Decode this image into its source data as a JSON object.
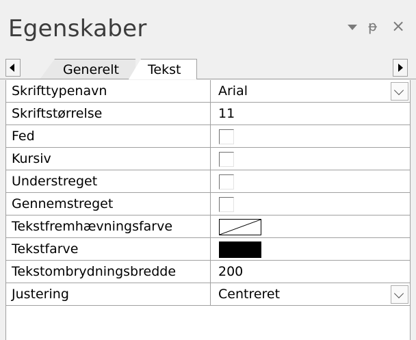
{
  "panel": {
    "title": "Egenskaber",
    "controls": {
      "dropdown_icon": "dropdown-arrow-icon",
      "pin_icon": "pin-icon",
      "pin_glyph": "ᵽ",
      "close_icon": "close-icon",
      "close_glyph": "×"
    }
  },
  "tabs": [
    {
      "label": "Generelt",
      "active": false
    },
    {
      "label": "Tekst",
      "active": true
    }
  ],
  "properties": [
    {
      "label": "Skrifttypenavn",
      "type": "dropdown",
      "value": "Arial"
    },
    {
      "label": "Skriftstørrelse",
      "type": "text",
      "value": "11"
    },
    {
      "label": "Fed",
      "type": "checkbox",
      "checked": false
    },
    {
      "label": "Kursiv",
      "type": "checkbox",
      "checked": false
    },
    {
      "label": "Understreget",
      "type": "checkbox",
      "checked": false
    },
    {
      "label": "Gennemstreget",
      "type": "checkbox",
      "checked": false
    },
    {
      "label": "Tekstfremhævningsfarve",
      "type": "color",
      "color": "none"
    },
    {
      "label": "Tekstfarve",
      "type": "color",
      "color": "#000000"
    },
    {
      "label": "Tekstombrydningsbredde",
      "type": "text",
      "value": "200"
    },
    {
      "label": "Justering",
      "type": "dropdown",
      "value": "Centreret"
    }
  ],
  "colors": {
    "panel_bg": "#f0f0f0",
    "grid_line": "#a0a0a0",
    "title_text": "#3c3c3c"
  }
}
